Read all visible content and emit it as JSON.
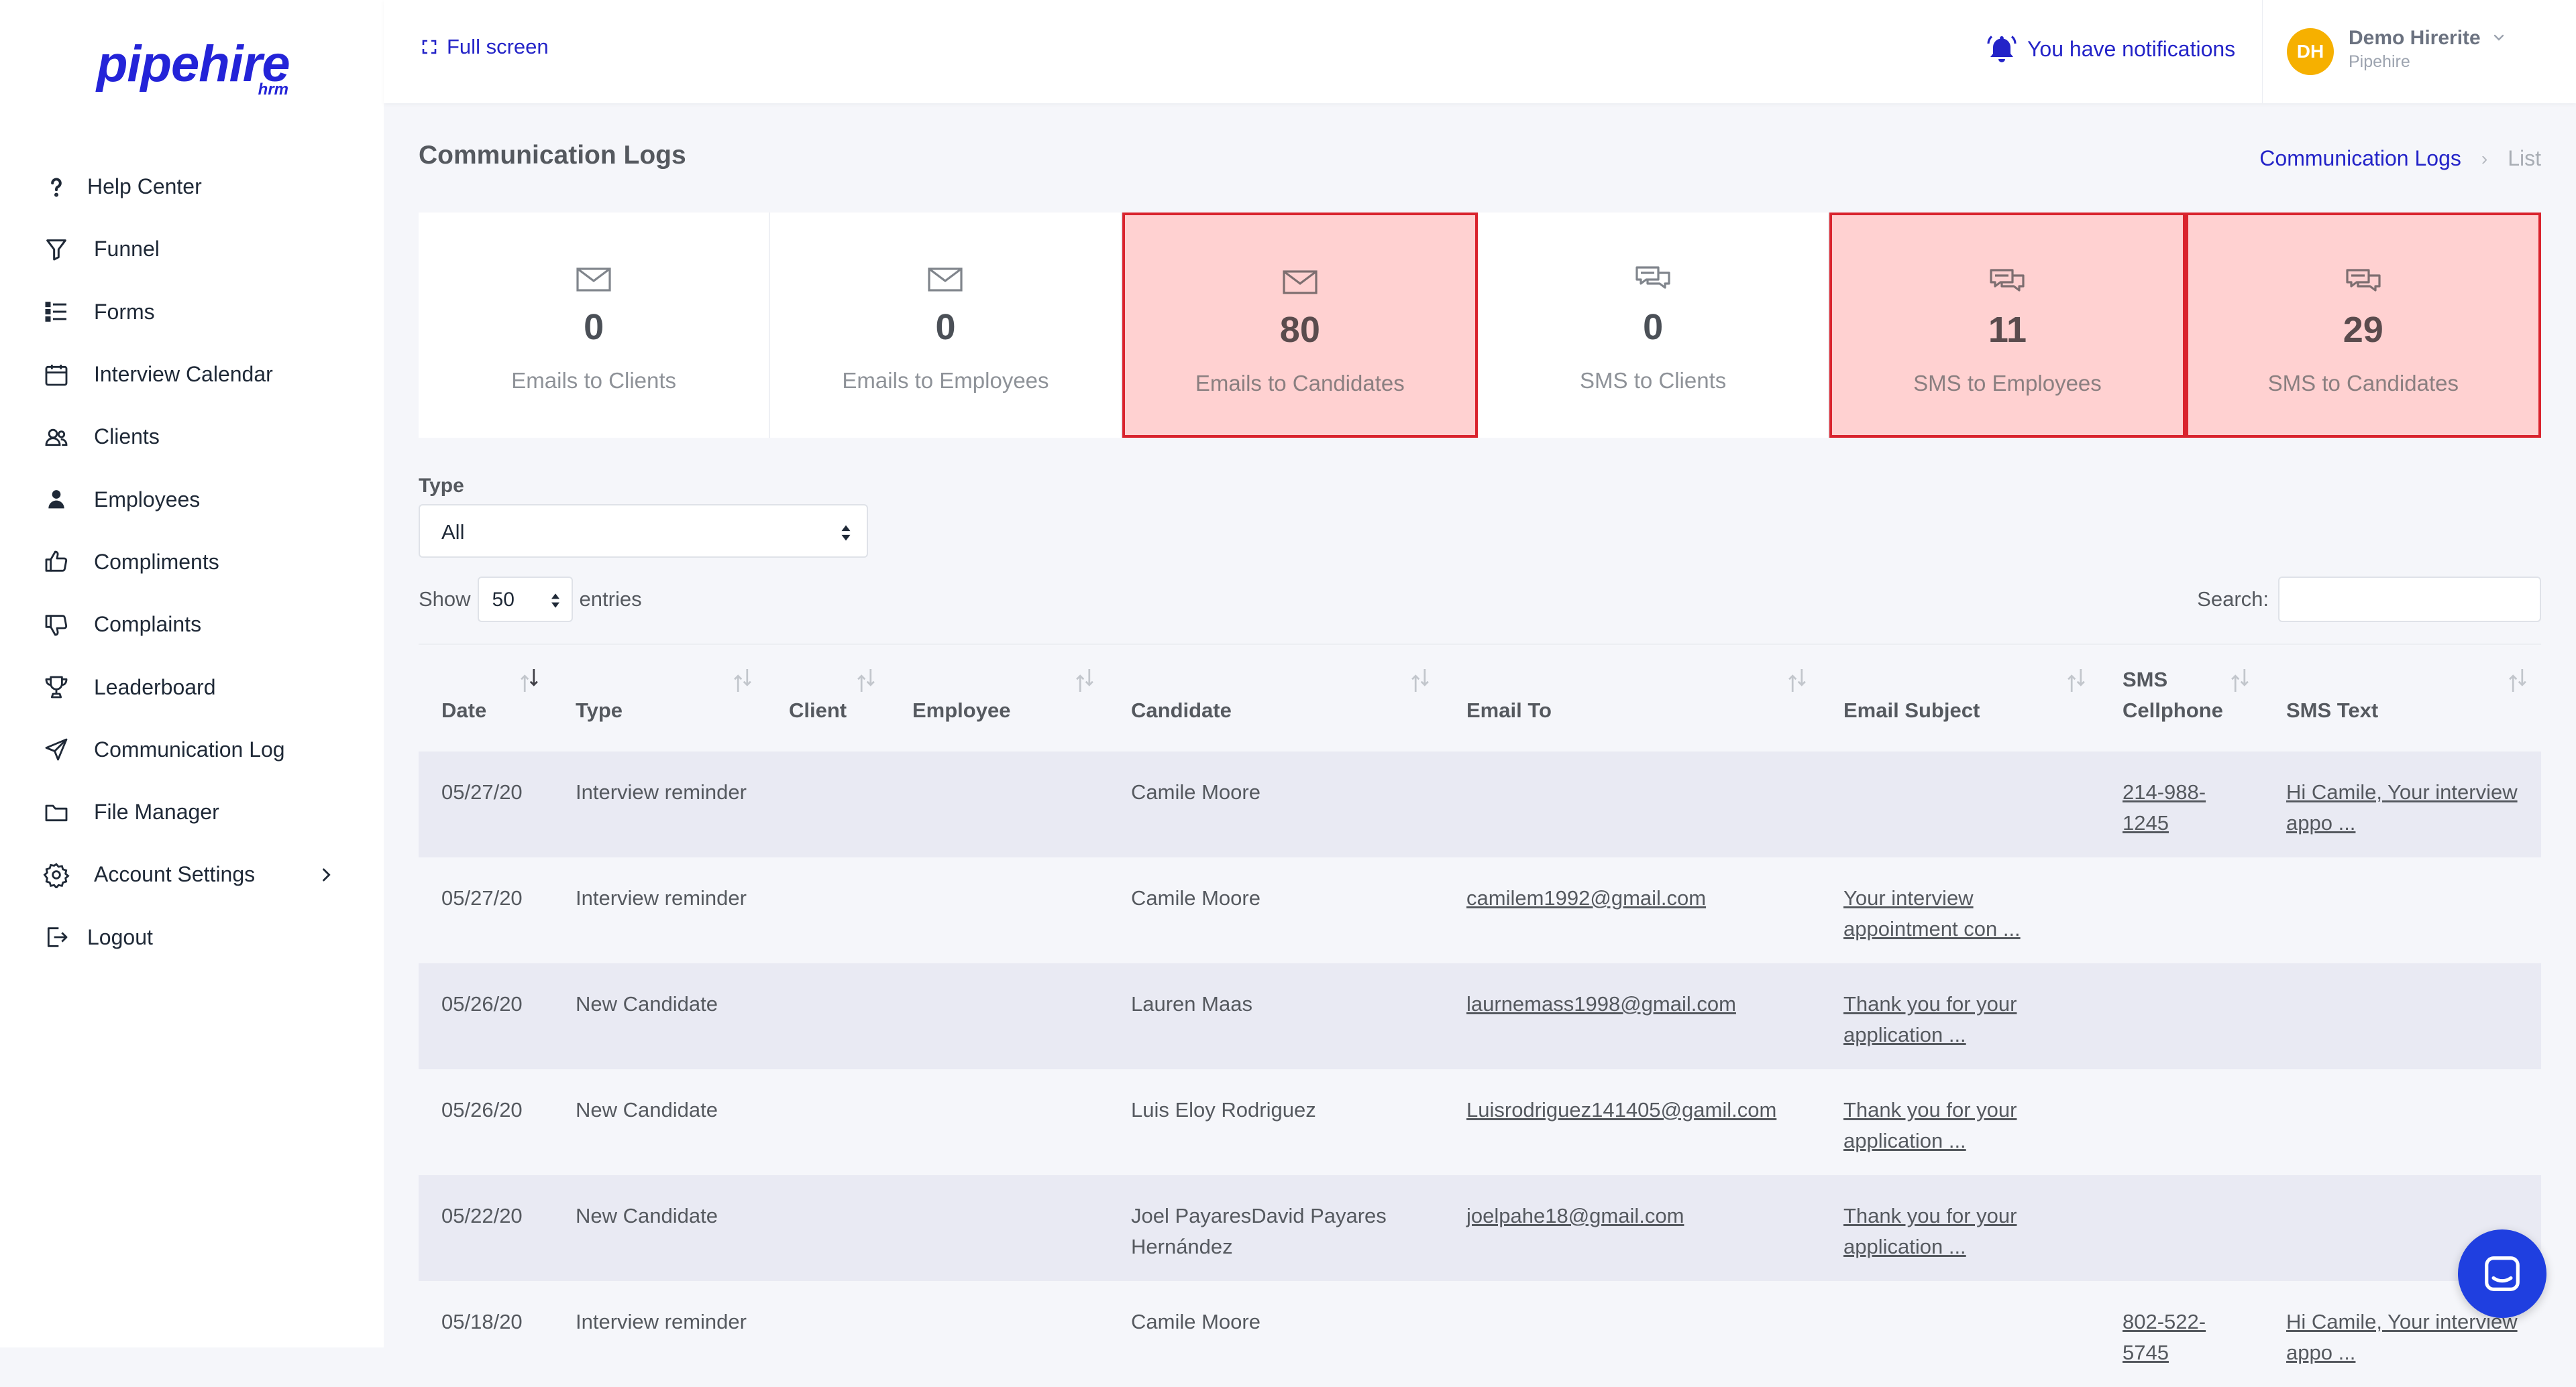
{
  "logo": {
    "main": "pipehire",
    "sub": "hrm"
  },
  "sidebar": {
    "items": [
      {
        "label": "Help Center",
        "icon": "question-icon"
      },
      {
        "label": "Funnel",
        "icon": "funnel-icon"
      },
      {
        "label": "Forms",
        "icon": "list-icon"
      },
      {
        "label": "Interview Calendar",
        "icon": "calendar-icon"
      },
      {
        "label": "Clients",
        "icon": "clients-icon"
      },
      {
        "label": "Employees",
        "icon": "employee-icon"
      },
      {
        "label": "Compliments",
        "icon": "thumbs-up-icon"
      },
      {
        "label": "Complaints",
        "icon": "thumbs-down-icon"
      },
      {
        "label": "Leaderboard",
        "icon": "trophy-icon"
      },
      {
        "label": "Communication Log",
        "icon": "send-icon"
      },
      {
        "label": "File Manager",
        "icon": "folder-icon"
      },
      {
        "label": "Account Settings",
        "icon": "gear-icon"
      },
      {
        "label": "Logout",
        "icon": "logout-icon"
      }
    ]
  },
  "header": {
    "fullscreen_label": "Full screen",
    "notifications_label": "You have notifications",
    "user": {
      "initials": "DH",
      "name": "Demo Hirerite",
      "org": "Pipehire"
    }
  },
  "page": {
    "title": "Communication Logs",
    "breadcrumb": {
      "link": "Communication Logs",
      "current": "List"
    }
  },
  "stats": [
    {
      "value": "0",
      "label": "Emails to Clients",
      "icon": "envelope-icon",
      "highlighted": false
    },
    {
      "value": "0",
      "label": "Emails to Employees",
      "icon": "envelope-icon",
      "highlighted": false
    },
    {
      "value": "80",
      "label": "Emails to Candidates",
      "icon": "envelope-icon",
      "highlighted": true
    },
    {
      "value": "0",
      "label": "SMS to Clients",
      "icon": "chat-bubbles-icon",
      "highlighted": false
    },
    {
      "value": "11",
      "label": "SMS to Employees",
      "icon": "chat-bubbles-icon",
      "highlighted": true
    },
    {
      "value": "29",
      "label": "SMS to Candidates",
      "icon": "chat-bubbles-icon",
      "highlighted": true
    }
  ],
  "filters": {
    "type_label": "Type",
    "type_value": "All",
    "show_label": "Show",
    "entries_value": "50",
    "entries_label": "entries",
    "search_label": "Search:",
    "search_value": ""
  },
  "table": {
    "columns": [
      "Date",
      "Type",
      "Client",
      "Employee",
      "Candidate",
      "Email To",
      "Email Subject",
      "SMS Cellphone",
      "SMS Text"
    ],
    "rows": [
      {
        "date": "05/27/20",
        "type": "Interview reminder",
        "client": "",
        "employee": "",
        "candidate": "Camile Moore",
        "email_to": "",
        "email_subject": "",
        "sms_cellphone": "214-988-1245",
        "sms_text": "Hi Camile, Your interview appo ..."
      },
      {
        "date": "05/27/20",
        "type": "Interview reminder",
        "client": "",
        "employee": "",
        "candidate": "Camile Moore",
        "email_to": "camilem1992@gmail.com",
        "email_subject": "Your interview appointment con ...",
        "sms_cellphone": "",
        "sms_text": ""
      },
      {
        "date": "05/26/20",
        "type": "New Candidate",
        "client": "",
        "employee": "",
        "candidate": "Lauren Maas",
        "email_to": "laurnemass1998@gmail.com",
        "email_subject": "Thank you for your application ...",
        "sms_cellphone": "",
        "sms_text": ""
      },
      {
        "date": "05/26/20",
        "type": "New Candidate",
        "client": "",
        "employee": "",
        "candidate": "Luis Eloy Rodriguez",
        "email_to": "Luisrodriguez141405@gamil.com",
        "email_subject": "Thank you for your application ...",
        "sms_cellphone": "",
        "sms_text": ""
      },
      {
        "date": "05/22/20",
        "type": "New Candidate",
        "client": "",
        "employee": "",
        "candidate": "Joel PayaresDavid Payares Hernández",
        "email_to": "joelpahe18@gmail.com",
        "email_subject": "Thank you for your application ...",
        "sms_cellphone": "",
        "sms_text": ""
      },
      {
        "date": "05/18/20",
        "type": "Interview reminder",
        "client": "",
        "employee": "",
        "candidate": "Camile Moore",
        "email_to": "",
        "email_subject": "",
        "sms_cellphone": "802-522-5745",
        "sms_text": "Hi Camile, Your interview appo ..."
      }
    ]
  },
  "colors": {
    "brand": "#2424d8",
    "link": "#2424c8",
    "highlight_fill": "#ffd1d1",
    "highlight_border": "#d9232d",
    "avatar": "#f6b000",
    "chat_button": "#1f3fe0"
  }
}
